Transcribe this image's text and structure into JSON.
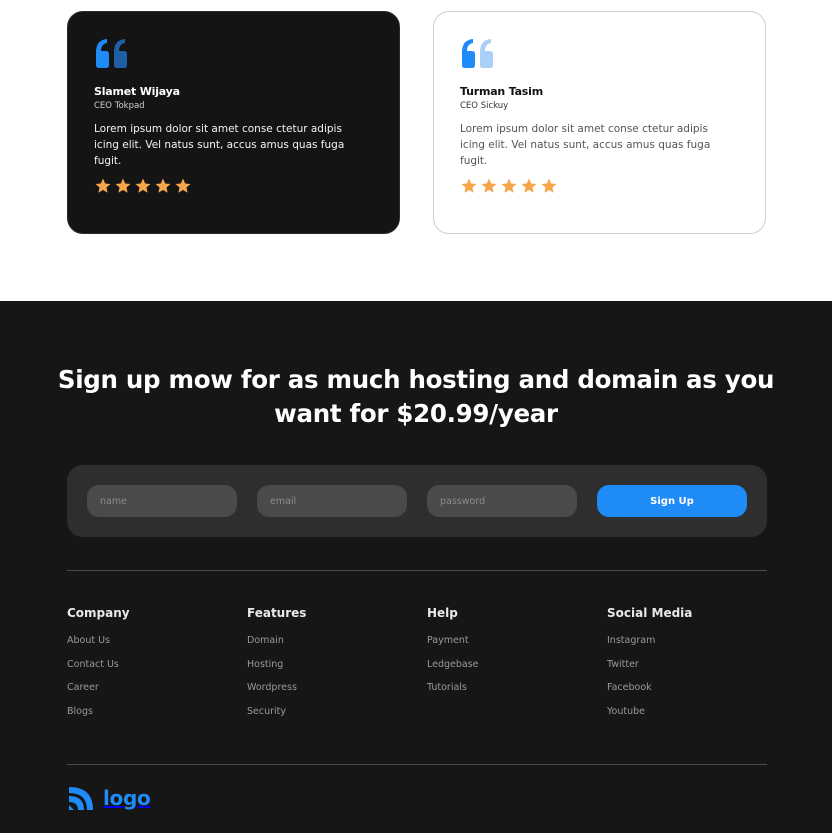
{
  "testimonials": [
    {
      "name": "Slamet Wijaya",
      "role": "CEO Tokpad",
      "text": "Lorem ipsum dolor sit amet conse ctetur adipis icing elit. Vel natus sunt, accus amus quas fuga fugit.",
      "rating": 5
    },
    {
      "name": "Turman Tasim",
      "role": "CEO Sickuy",
      "text": "Lorem ipsum dolor sit amet conse ctetur adipis icing elit. Vel natus sunt, accus amus quas fuga fugit.",
      "rating": 5
    }
  ],
  "cta": {
    "headline": "Sign up mow for as much hosting and domain as you want for $20.99/year"
  },
  "signup": {
    "name_placeholder": "name",
    "email_placeholder": "email",
    "password_placeholder": "password",
    "button_label": "Sign Up"
  },
  "footer": {
    "columns": [
      {
        "title": "Company",
        "links": [
          "About Us",
          "Contact Us",
          "Career",
          "Blogs"
        ]
      },
      {
        "title": "Features",
        "links": [
          "Domain",
          "Hosting",
          "Wordpress",
          "Security"
        ]
      },
      {
        "title": "Help",
        "links": [
          "Payment",
          "Ledgebase",
          "Tutorials"
        ]
      },
      {
        "title": "Social Media",
        "links": [
          "Instagram",
          "Twitter",
          "Facebook",
          "Youtube"
        ]
      }
    ],
    "logo_text": "logo"
  },
  "colors": {
    "accent": "#1f8bf7",
    "star": "#f4a64b",
    "dark_bg": "#161616"
  },
  "icons": {
    "quote": "quote-icon",
    "star": "star-icon",
    "logo": "logo-mark-icon"
  }
}
